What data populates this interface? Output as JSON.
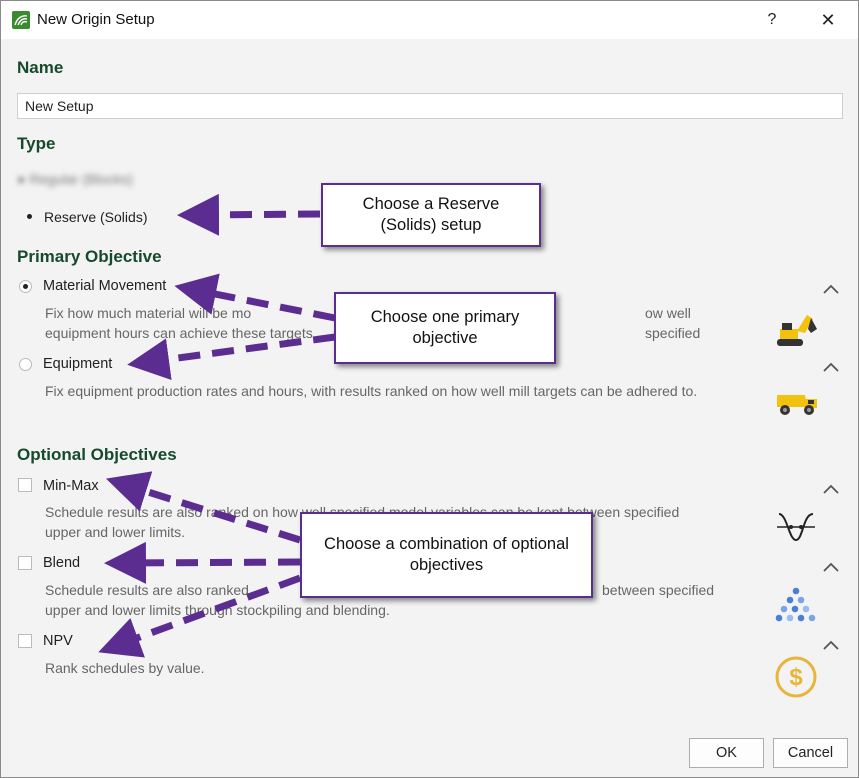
{
  "window": {
    "title": "New Origin Setup",
    "help_label": "?",
    "close_label": "✕"
  },
  "name_section": {
    "heading": "Name",
    "value": "New Setup"
  },
  "type_section": {
    "heading": "Type",
    "blurred_option": "Regular (Blocks)",
    "reserve_option": "Reserve (Solids)"
  },
  "primary": {
    "heading": "Primary Objective",
    "material": {
      "label": "Material Movement",
      "desc_visible": "Fix how much material will be mo",
      "desc_right": "ow well specified",
      "desc_line2": "equipment hours can achieve these targets"
    },
    "equipment": {
      "label": "Equipment",
      "desc": "Fix equipment production rates and hours, with results ranked on how well mill targets can be adhered to."
    }
  },
  "optional": {
    "heading": "Optional Objectives",
    "minmax": {
      "label": "Min-Max",
      "desc_line1": "Schedule results are also ranked on how well specified model variables can be kept between specified",
      "desc_line2": "upper and lower limits."
    },
    "blend": {
      "label": "Blend",
      "desc_line1_left": "Schedule results are also ranked",
      "desc_line1_right": "between specified",
      "desc_line2": "upper and lower limits through stockpiling and blending."
    },
    "npv": {
      "label": "NPV",
      "desc": "Rank schedules by value."
    }
  },
  "callouts": {
    "reserve": "Choose a Reserve (Solids) setup",
    "primary": "Choose one primary objective",
    "optional": "Choose a combination of optional objectives"
  },
  "footer": {
    "ok_label": "OK",
    "cancel_label": "Cancel"
  },
  "colors": {
    "heading": "#174a2c",
    "callout_border": "#5c2d91",
    "arrow": "#5c2d91",
    "npv_icon": "#e8b53a"
  },
  "icons": [
    "excavator-icon",
    "dump-truck-icon",
    "min-max-curve-icon",
    "blend-triangle-icon",
    "dollar-coin-icon"
  ]
}
